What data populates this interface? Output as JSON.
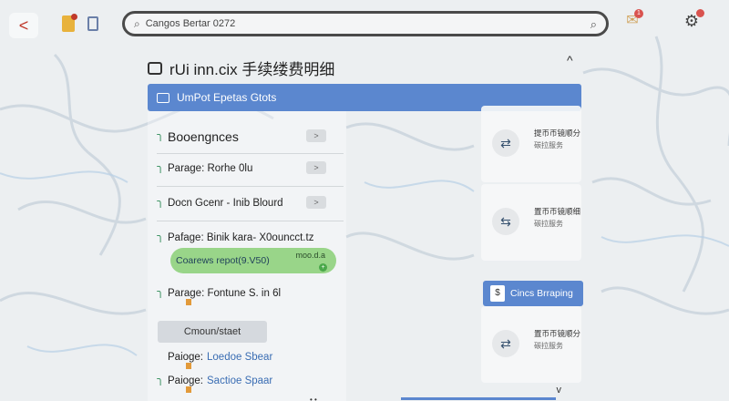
{
  "topbar": {
    "back_glyph": "<",
    "search_text": "Cangos Bertar 0272",
    "search_icon": "search-icon",
    "notif_badge": "1"
  },
  "page": {
    "title": "rUi inn.cix 手续缕费明细",
    "collapse_glyph": "^"
  },
  "header": {
    "label": "UmPot Epetas Gtots"
  },
  "list": {
    "items": [
      {
        "label": "Booengnces",
        "mark": "ך"
      },
      {
        "label": "Parage: Rorhe 0lu",
        "mark": "ך"
      },
      {
        "label": "Docn Gcenr - Inib Blourd",
        "mark": "ך"
      },
      {
        "label": "Pafage: Binik kara- X0ouncct.tz",
        "mark": "ך"
      },
      {
        "label": "Parage: Fontune S. in 6l",
        "mark": "ך"
      },
      {
        "label": "Paioge:",
        "link": "Loedoe Sbear",
        "mark": ""
      },
      {
        "label": "Paioge:",
        "link": "Sactioe Spaar",
        "mark": "ך"
      }
    ],
    "chevron": ">"
  },
  "highlight": {
    "text": "Coarews repot(9.V50)",
    "right_text": "moo.d.a",
    "dot": "+"
  },
  "grey_button": {
    "label": "Cmoun/staet"
  },
  "cards": [
    {
      "line1": "提币币镜顺分",
      "line2": "碳拉服务"
    },
    {
      "line1": "置币币镜顺细",
      "line2": "碳拉服务"
    },
    {
      "line1": "置币币镜顺分",
      "line2": "碳拉服务"
    }
  ],
  "blue_pill": {
    "icon_glyph": "$",
    "label": "Cincs Brraping"
  },
  "bottom": {
    "dots": "• •",
    "chevron": "v"
  }
}
